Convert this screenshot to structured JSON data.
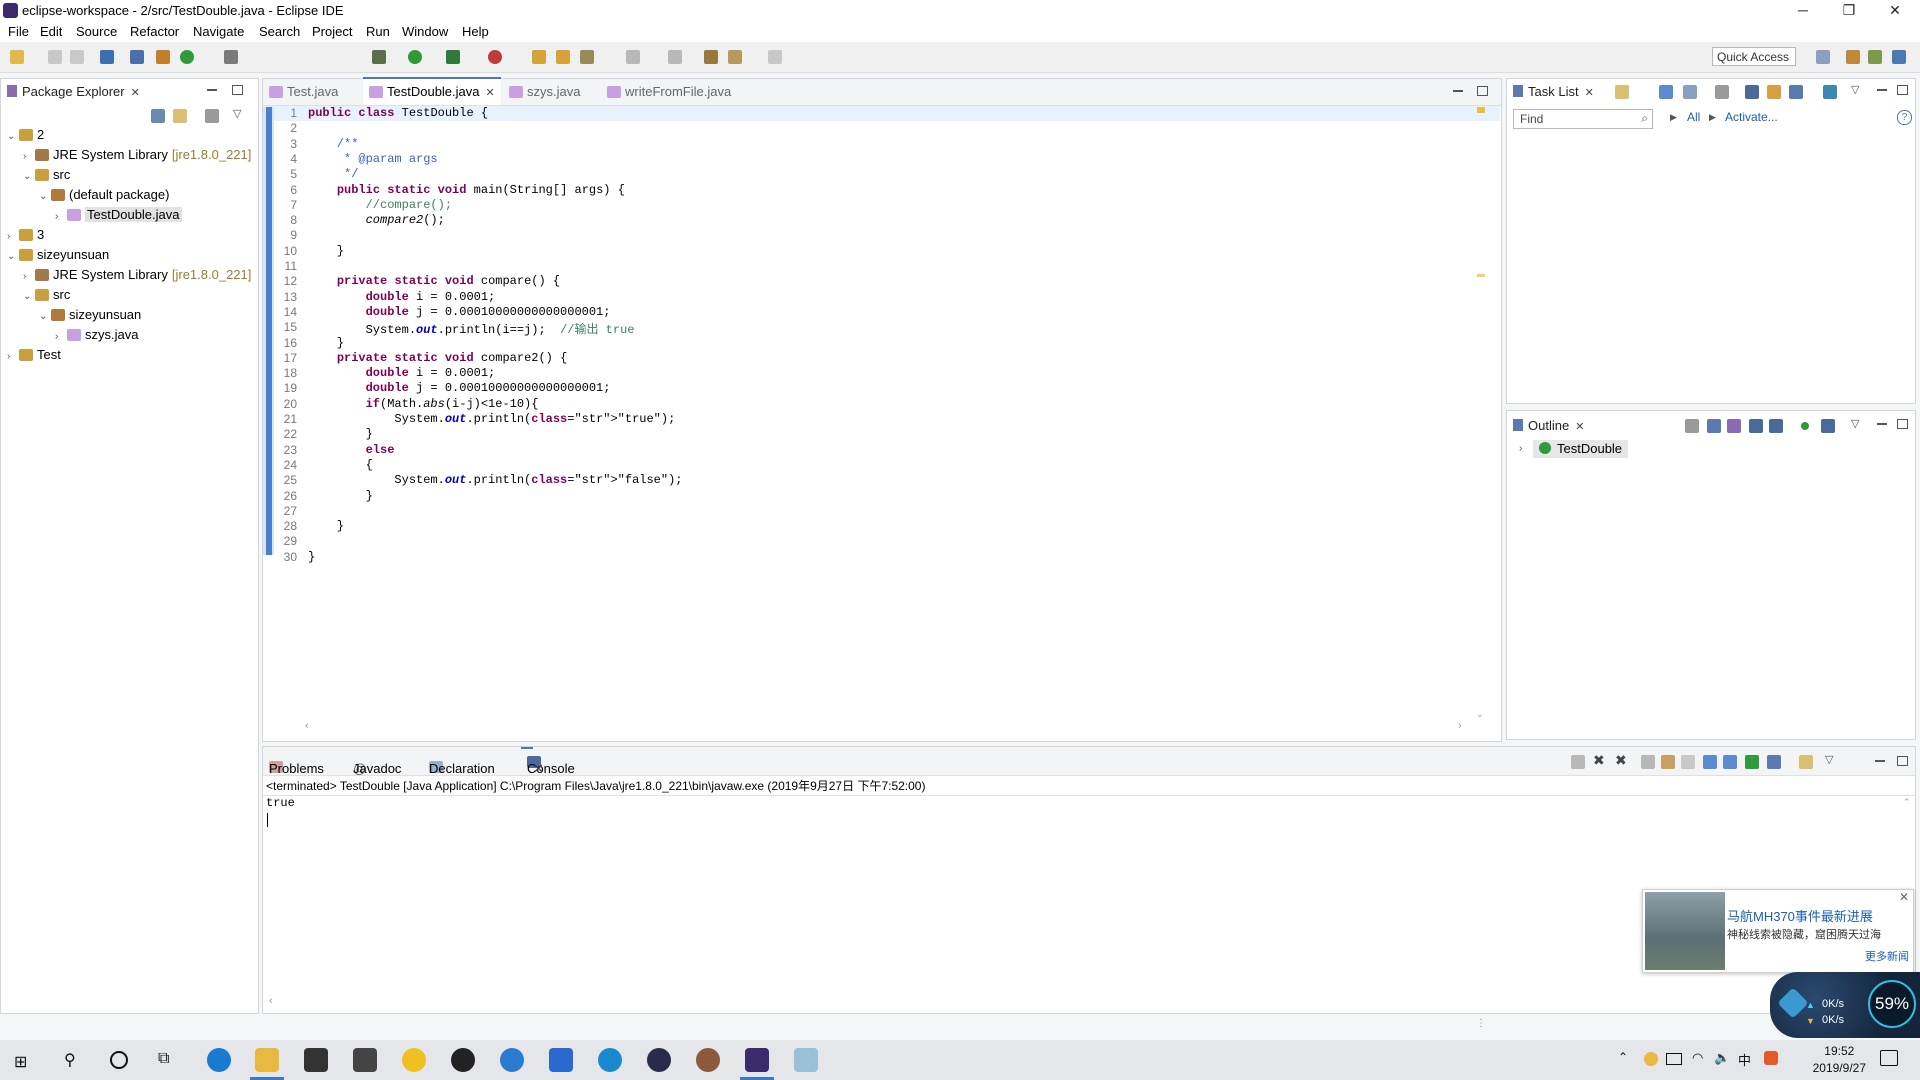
{
  "window": {
    "title": "eclipse-workspace - 2/src/TestDouble.java - Eclipse IDE",
    "minimize": "─",
    "restore": "❐",
    "close": "✕"
  },
  "menu": [
    "File",
    "Edit",
    "Source",
    "Refactor",
    "Navigate",
    "Search",
    "Project",
    "Run",
    "Window",
    "Help"
  ],
  "toolbar": {
    "quick_access": "Quick Access"
  },
  "package_explorer": {
    "title": "Package Explorer",
    "tree": [
      {
        "label": "2",
        "extra": "",
        "arrow": "⌄",
        "depth": 0,
        "icon": "project-icon"
      },
      {
        "label": "JRE System Library",
        "extra": "[jre1.8.0_221]",
        "arrow": "›",
        "depth": 1,
        "icon": "library-icon"
      },
      {
        "label": "src",
        "extra": "",
        "arrow": "⌄",
        "depth": 1,
        "icon": "source-folder-icon"
      },
      {
        "label": "(default package)",
        "extra": "",
        "arrow": "⌄",
        "depth": 2,
        "icon": "package-icon"
      },
      {
        "label": "TestDouble.java",
        "extra": "",
        "arrow": "›",
        "depth": 3,
        "icon": "java-file-icon"
      },
      {
        "label": "3",
        "extra": "",
        "arrow": "›",
        "depth": 0,
        "icon": "project-icon"
      },
      {
        "label": "sizeyunsuan",
        "extra": "",
        "arrow": "⌄",
        "depth": 0,
        "icon": "project-icon"
      },
      {
        "label": "JRE System Library",
        "extra": "[jre1.8.0_221]",
        "arrow": "›",
        "depth": 1,
        "icon": "library-icon"
      },
      {
        "label": "src",
        "extra": "",
        "arrow": "⌄",
        "depth": 1,
        "icon": "source-folder-icon"
      },
      {
        "label": "sizeyunsuan",
        "extra": "",
        "arrow": "⌄",
        "depth": 2,
        "icon": "package-icon"
      },
      {
        "label": "szys.java",
        "extra": "",
        "arrow": "›",
        "depth": 3,
        "icon": "java-file-icon"
      },
      {
        "label": "Test",
        "extra": "",
        "arrow": "›",
        "depth": 0,
        "icon": "project-icon"
      }
    ]
  },
  "editor": {
    "tabs": [
      "Test.java",
      "TestDouble.java",
      "szys.java",
      "writeFromFile.java"
    ],
    "active_tab": 1,
    "line_numbers": [
      "1",
      "2",
      "3",
      "4",
      "5",
      "6",
      "7",
      "8",
      "9",
      "10",
      "11",
      "12",
      "13",
      "14",
      "15",
      "16",
      "17",
      "18",
      "19",
      "20",
      "21",
      "22",
      "23",
      "24",
      "25",
      "26",
      "27",
      "28",
      "29",
      "30"
    ],
    "lines": [
      "public class TestDouble {",
      "",
      "    /**",
      "     * @param args",
      "     */",
      "    public static void main(String[] args) {",
      "        //compare();",
      "        compare2();",
      "",
      "    }",
      "",
      "    private static void compare() {",
      "        double i = 0.0001;",
      "        double j = 0.00010000000000000001;",
      "        System.out.println(i==j);  //输出 true",
      "    }",
      "    private static void compare2() {",
      "        double i = 0.0001;",
      "        double j = 0.00010000000000000001;",
      "        if(Math.abs(i-j)<1e-10){",
      "            System.out.println(\"true\");",
      "        }",
      "        else",
      "        {",
      "            System.out.println(\"false\");",
      "        }",
      "",
      "    }",
      "",
      "}"
    ]
  },
  "task_list": {
    "title": "Task List",
    "find_placeholder": "Find",
    "all_label": "All",
    "activate_label": "Activate..."
  },
  "outline": {
    "title": "Outline",
    "item": "TestDouble"
  },
  "bottom": {
    "tabs": [
      "Problems",
      "Javadoc",
      "Declaration",
      "Console"
    ],
    "active_tab": 3,
    "console_header": "<terminated> TestDouble [Java Application] C:\\Program Files\\Java\\jre1.8.0_221\\bin\\javaw.exe (2019年9月27日 下午7:52:00)",
    "output": "true"
  },
  "news_popup": {
    "headline": "马航MH370事件最新进展",
    "subline": "神秘线索被隐藏，窟困腾天过海",
    "more": "更多新闻",
    "close": "✕"
  },
  "net_widget": {
    "upload": "0K/s",
    "download": "0K/s",
    "percent": "59%"
  },
  "taskbar": {
    "time": "19:52",
    "date": "2019/9/27"
  }
}
